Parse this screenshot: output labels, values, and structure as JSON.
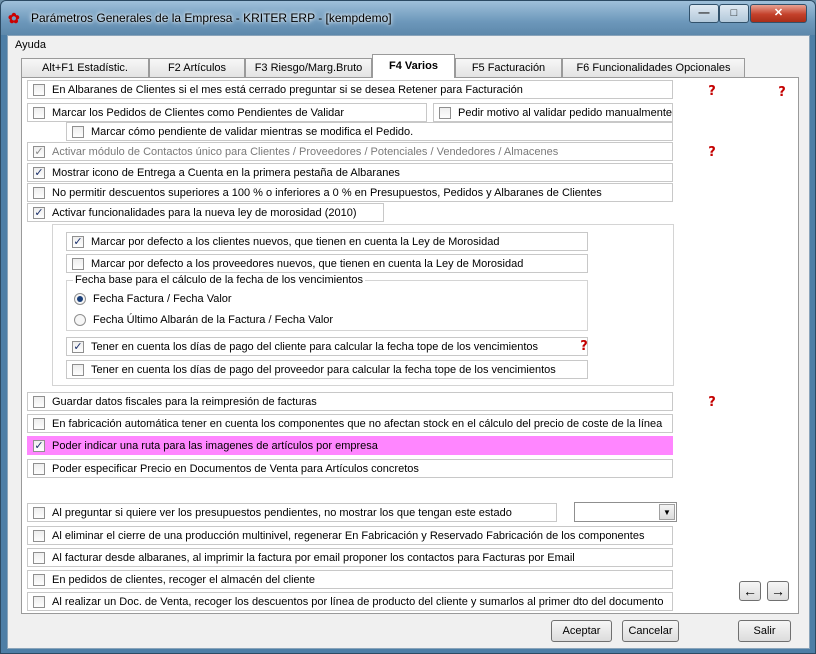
{
  "window": {
    "title": "Parámetros Generales de la Empresa - KRITER ERP - [kempdemo]",
    "min_glyph": "—",
    "max_glyph": "□",
    "close_glyph": "✕"
  },
  "menu": {
    "ayuda": "Ayuda"
  },
  "tabs": [
    {
      "label": "Alt+F1 Estadístic."
    },
    {
      "label": "F2 Artículos"
    },
    {
      "label": "F3 Riesgo/Marg.Bruto"
    },
    {
      "label": "F4 Varios",
      "active": true
    },
    {
      "label": "F5 Facturación"
    },
    {
      "label": "F6 Funcionalidades Opcionales"
    }
  ],
  "options": {
    "o1": {
      "label": "En Albaranes de Clientes si el mes está cerrado preguntar si se desea Retener para Facturación",
      "checked": false
    },
    "o2": {
      "label": "Marcar los Pedidos de Clientes como Pendientes de Validar",
      "checked": false
    },
    "o2b": {
      "label": "Pedir motivo al validar pedido manualmente",
      "checked": false
    },
    "o3": {
      "label": "Marcar cómo pendiente de validar mientras se modifica el Pedido.",
      "checked": false
    },
    "o4": {
      "label": "Activar módulo de Contactos único para Clientes / Proveedores / Potenciales / Vendedores / Almacenes",
      "checked": true
    },
    "o5": {
      "label": "Mostrar icono de Entrega a Cuenta en la primera pestaña de Albaranes",
      "checked": true
    },
    "o6": {
      "label": "No permitir descuentos superiores a 100 % o inferiores a 0 % en Presupuestos, Pedidos y Albaranes de Clientes",
      "checked": false
    },
    "o7": {
      "label": "Activar funcionalidades para la nueva ley de morosidad (2010)",
      "checked": true
    },
    "m1": {
      "label": "Marcar por defecto a los clientes nuevos, que tienen en cuenta la Ley de Morosidad",
      "checked": true
    },
    "m2": {
      "label": "Marcar por defecto a los proveedores nuevos, que tienen en cuenta la Ley de Morosidad",
      "checked": false
    },
    "fecha_title": "Fecha base para el cálculo de la fecha de los vencimientos",
    "r1": {
      "label": "Fecha Factura / Fecha Valor",
      "selected": true
    },
    "r2": {
      "label": "Fecha Último Albarán de la Factura / Fecha Valor",
      "selected": false
    },
    "m3": {
      "label": "Tener en cuenta los días de pago del cliente para calcular la fecha tope de los vencimientos",
      "checked": true
    },
    "m4": {
      "label": "Tener en cuenta los días de pago del proveedor para calcular la fecha tope de los vencimientos",
      "checked": false
    },
    "o8": {
      "label": "Guardar datos fiscales para la reimpresión de facturas",
      "checked": false
    },
    "o9": {
      "label": "En fabricación automática tener en cuenta los componentes que no afectan stock en el cálculo del precio de coste de la línea",
      "checked": false
    },
    "o10": {
      "label": "Poder indicar una ruta para las imagenes de artículos por empresa",
      "checked": true
    },
    "o11": {
      "label": "Poder especificar Precio en Documentos de Venta para Artículos concretos",
      "checked": false
    },
    "o12": {
      "label": "Al preguntar si quiere ver los presupuestos pendientes, no mostrar los que tengan este estado",
      "checked": false
    },
    "o13": {
      "label": "Al eliminar el cierre de una producción multinivel, regenerar En Fabricación y Reservado Fabricación de los componentes",
      "checked": false
    },
    "o14": {
      "label": "Al facturar desde albaranes, al imprimir la factura por email proponer los contactos para Facturas por Email",
      "checked": false
    },
    "o15": {
      "label": "En pedidos de clientes, recoger el almacén del cliente",
      "checked": false
    },
    "o16": {
      "label": "Al realizar un Doc. de Venta, recoger los descuentos por línea de producto del cliente y sumarlos al primer dto del documento",
      "checked": false
    }
  },
  "glyphs": {
    "check": "✓",
    "help": "?",
    "combo_arrow": "▼",
    "prev": "←",
    "next": "→"
  },
  "buttons": {
    "accept": "Aceptar",
    "cancel": "Cancelar",
    "exit": "Salir"
  },
  "colors": {
    "highlight": "#ff86ff"
  }
}
